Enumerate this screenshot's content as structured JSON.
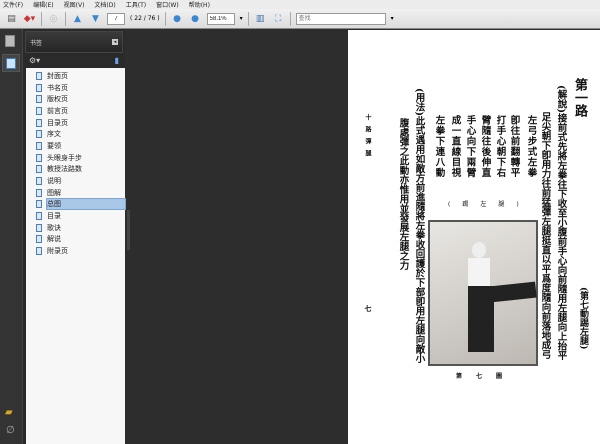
{
  "menu": [
    "文件(F)",
    "编辑(E)",
    "视图(V)",
    "文档(D)",
    "工具(T)",
    "窗口(W)",
    "帮助(H)"
  ],
  "toolbar": {
    "page_current": "7",
    "page_info": "( 22 / 76 )",
    "zoom": "58.1%",
    "search_placeholder": "查找"
  },
  "panel": {
    "title": "书签"
  },
  "bookmarks": [
    "封面页",
    "书名页",
    "版权页",
    "前言页",
    "目录页",
    "序文",
    "要领",
    "头眼身手步",
    "教授法路数",
    "说明",
    "图解",
    "总图",
    "目录",
    "歌诀",
    "解说",
    "附录页"
  ],
  "selected_bookmark": "总图",
  "doc": {
    "title": "第一路",
    "subtitle": "(第七動踢左腿)",
    "columns": [
      "(解說)接前式先將左拳往下收至小腹前手心向前隨用左腿向上抬平",
      "足尖朝下卽用力往前猛彈左腿挺直以平爲度隨向前落地成弓",
      "左弓步式左拳",
      "卽往前翻轉平",
      "打手心朝下右",
      "臂隨往後伸直",
      "手心向下兩臂",
      "成一直線目視",
      "左拳下連八動",
      "(用法)此式遇用如敵方前進隨將左拳收回護於下部卽用左腿向敵小",
      "腹處彈之此動亦惟用並發展左腿之力"
    ],
    "photo_caption_top": "(踢左腿)",
    "photo_caption_bottom": "第七圖",
    "running_head": "十路彈腿",
    "page_number": "七"
  }
}
